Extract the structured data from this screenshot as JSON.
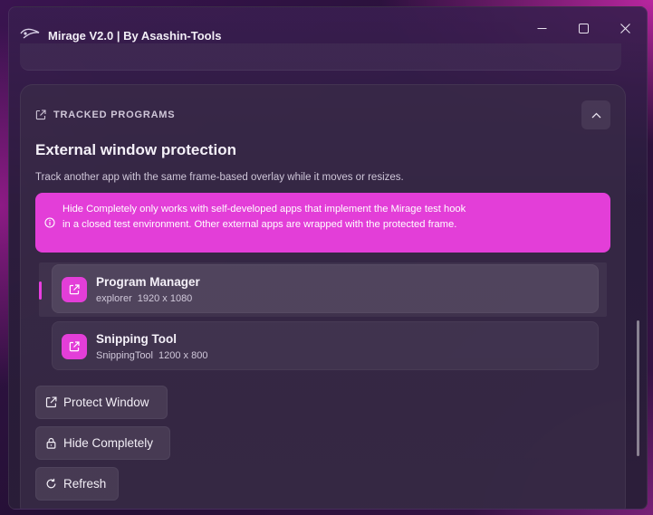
{
  "window": {
    "title": "Mirage V2.0 | By Asashin-Tools",
    "app_icon": "mirage-logo-icon",
    "caption_buttons": [
      "minimize-icon",
      "maximize-icon",
      "close-icon"
    ]
  },
  "section": {
    "label": "TRACKED PROGRAMS",
    "icon": "external-link-icon",
    "heading": "External window protection",
    "description": "Track another app with the same frame-based overlay while it moves or resizes.",
    "collapse_icon": "chevron-up-icon"
  },
  "banner": {
    "icon": "info-icon",
    "text": "Hide Completely only works with self-developed apps that implement the Mirage test hook in a closed test environment. Other external apps are wrapped with the protected frame.",
    "color": "#e33ed8"
  },
  "programs": [
    {
      "name": "Program Manager",
      "process": "explorer",
      "size": "1920 x 1080",
      "selected": true
    },
    {
      "name": "Snipping Tool",
      "process": "SnippingTool",
      "size": "1200 x 800",
      "selected": false
    }
  ],
  "buttons": {
    "protect": "Protect Window",
    "hide": "Hide Completely",
    "refresh": "Refresh"
  },
  "colors": {
    "accent": "#e33ed8",
    "surface": "#3a2c48"
  }
}
